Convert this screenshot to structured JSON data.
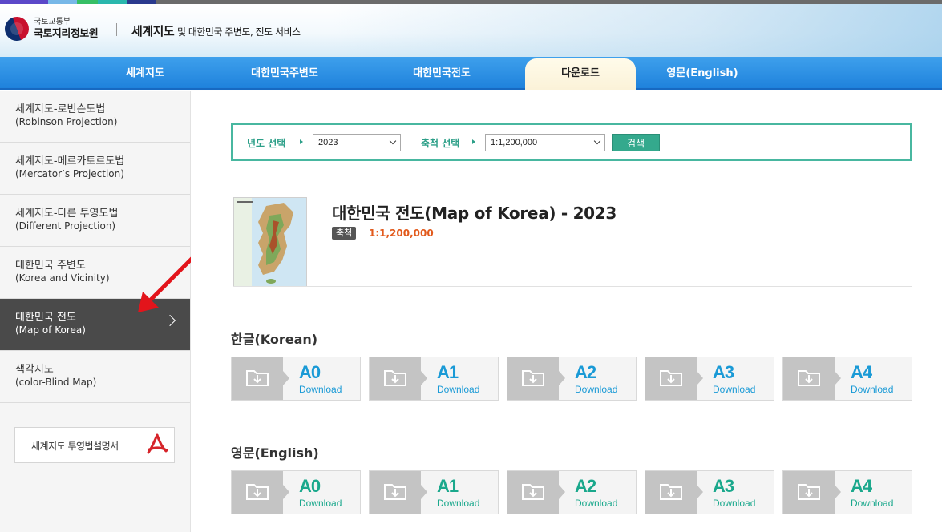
{
  "colors": {
    "strip": [
      "#5b48c9",
      "#78b8e8",
      "#37bf66",
      "#2ab7ad",
      "#2b3a8e",
      "#6b6b6b"
    ],
    "nav_bg": "#1f82dc",
    "accent_teal": "#48b7a0",
    "download_ko": "#1a9ad6",
    "download_en": "#1aa88c",
    "scale_value": "#e25a1c",
    "active_side": "#4a4a4a"
  },
  "header": {
    "ministry": "국토교통부",
    "org": "국토지리정보원",
    "service_title": "세계지도",
    "service_sub": "및 대한민국 주변도, 전도 서비스"
  },
  "nav": {
    "items": [
      "세계지도",
      "대한민국주변도",
      "대한민국전도",
      "다운로드",
      "영문(English)"
    ],
    "active": "다운로드"
  },
  "sidebar": {
    "items": [
      {
        "ko": "세계지도-로빈슨도법",
        "en": "(Robinson Projection)"
      },
      {
        "ko": "세계지도-메르카토르도법",
        "en": "(Mercator’s Projection)"
      },
      {
        "ko": "세계지도-다른 투영도법",
        "en": "(Different Projection)"
      },
      {
        "ko": "대한민국 주변도",
        "en": "(Korea and Vicinity)"
      },
      {
        "ko": "대한민국 전도",
        "en": "(Map of Korea)"
      },
      {
        "ko": "색각지도",
        "en": "(color-Blind Map)"
      }
    ],
    "active_index": 4,
    "pdf_button": {
      "label": "세계지도 투영법설명서",
      "icon": "pdf-icon"
    }
  },
  "search": {
    "year_label": "년도 선택",
    "year_value": "2023",
    "scale_label": "축척 선택",
    "scale_value": "1:1,200,000",
    "button": "검색"
  },
  "map": {
    "title": "대한민국 전도(Map of Korea) - 2023",
    "scale_badge": "축척",
    "scale_value": "1:1,200,000"
  },
  "sections": [
    {
      "title": "한글(Korean)",
      "downloads": [
        {
          "size": "A0",
          "label": "Download"
        },
        {
          "size": "A1",
          "label": "Download"
        },
        {
          "size": "A2",
          "label": "Download"
        },
        {
          "size": "A3",
          "label": "Download"
        },
        {
          "size": "A4",
          "label": "Download"
        }
      ]
    },
    {
      "title": "영문(English)",
      "downloads": [
        {
          "size": "A0",
          "label": "Download"
        },
        {
          "size": "A1",
          "label": "Download"
        },
        {
          "size": "A2",
          "label": "Download"
        },
        {
          "size": "A3",
          "label": "Download"
        },
        {
          "size": "A4",
          "label": "Download"
        }
      ]
    }
  ]
}
